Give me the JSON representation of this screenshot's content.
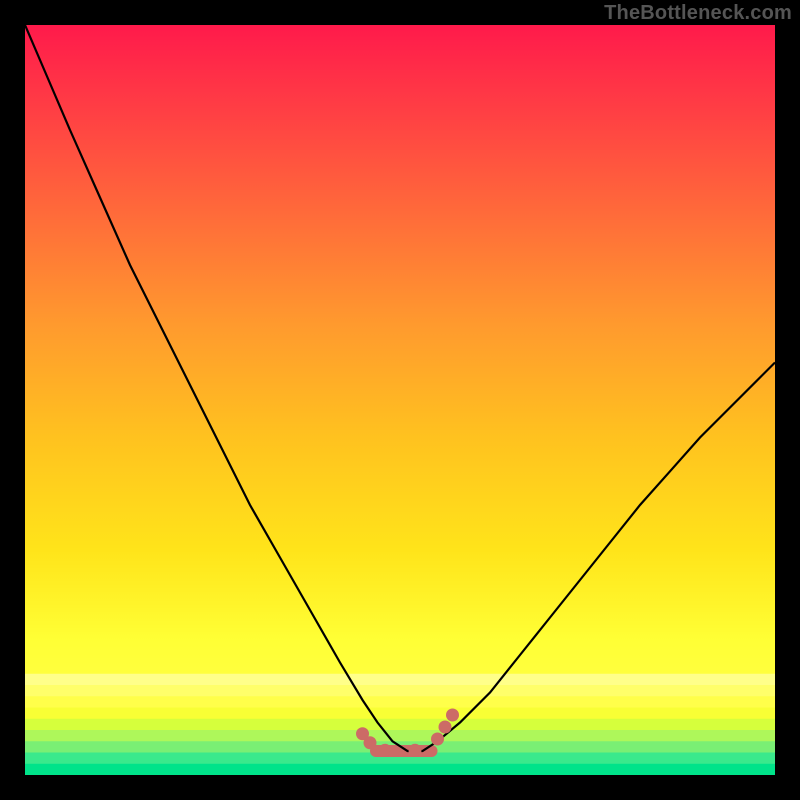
{
  "watermark": "TheBottleneck.com",
  "chart_data": {
    "type": "line",
    "title": "",
    "xlabel": "",
    "ylabel": "",
    "xlim": [
      0,
      100
    ],
    "ylim": [
      0,
      100
    ],
    "grid": false,
    "legend": false,
    "background_gradient": {
      "top_color": "#ff1a4b",
      "mid_color": "#ffd21f",
      "bottom_color": "#00e38a",
      "bands_near_bottom": [
        "#ffff8a",
        "#ffff6a",
        "#ffff4a",
        "#f8ff35",
        "#d6ff3c",
        "#aef75a",
        "#7aef74",
        "#3ae98c",
        "#00e38a"
      ]
    },
    "series": [
      {
        "name": "curve",
        "color": "#000000",
        "x": [
          0,
          3,
          6,
          10,
          14,
          18,
          22,
          26,
          30,
          34,
          38,
          42,
          45,
          47,
          49,
          51,
          53,
          55,
          58,
          62,
          66,
          70,
          74,
          78,
          82,
          86,
          90,
          94,
          98,
          100
        ],
        "y": [
          100,
          93,
          86,
          77,
          68,
          60,
          52,
          44,
          36,
          29,
          22,
          15,
          10,
          7,
          4.5,
          3.2,
          3.2,
          4.5,
          7,
          11,
          16,
          21,
          26,
          31,
          36,
          40.5,
          45,
          49,
          53,
          55
        ]
      },
      {
        "name": "highlight-marks",
        "color": "#cc6b66",
        "type": "scatter",
        "x": [
          45,
          46,
          48,
          52,
          55,
          56,
          57
        ],
        "y": [
          5.5,
          4.3,
          3.3,
          3.3,
          4.8,
          6.4,
          8.0
        ]
      },
      {
        "name": "highlight-band",
        "color": "#cc6b66",
        "type": "area",
        "x": [
          46,
          55
        ],
        "y": [
          3.2,
          3.2
        ]
      }
    ]
  }
}
